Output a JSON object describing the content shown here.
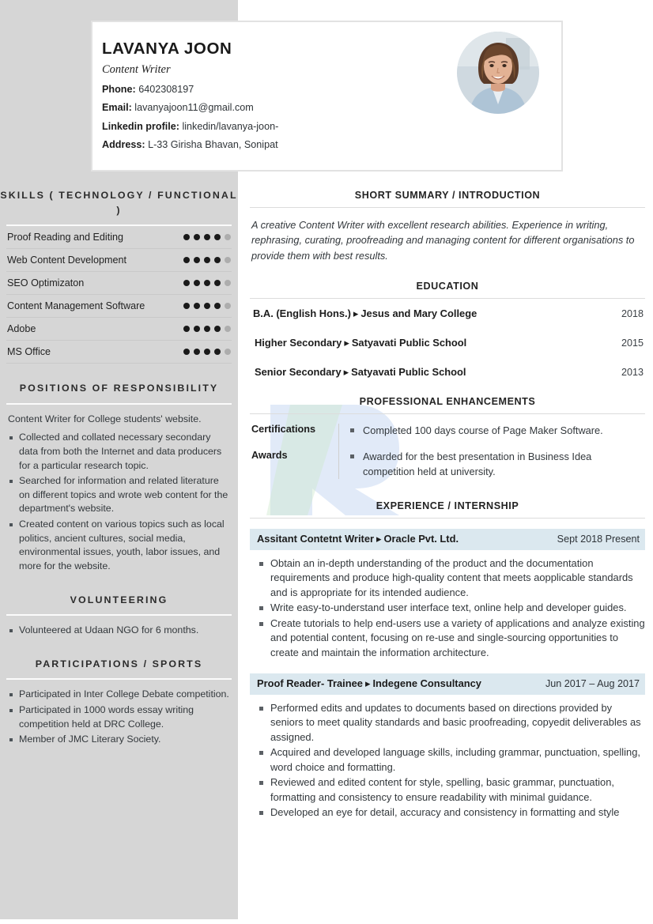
{
  "header": {
    "name": "LAVANYA JOON",
    "job_title": "Content Writer",
    "contacts": [
      {
        "label": "Phone:",
        "value": "6402308197"
      },
      {
        "label": "Email:",
        "value": "lavanyajoon11@gmail.com"
      },
      {
        "label": "Linkedin profile:",
        "value": "linkedin/lavanya-joon-"
      },
      {
        "label": "Address:",
        "value": "L-33 Girisha Bhavan, Sonipat"
      }
    ],
    "photo_alt": "profile-photo"
  },
  "sidebar": {
    "skills": {
      "heading": "SKILLS ( TECHNOLOGY / FUNCTIONAL )",
      "rating_max": 5,
      "items": [
        {
          "name": "Proof Reading and Editing",
          "rating": 4
        },
        {
          "name": "Web Content Development",
          "rating": 4
        },
        {
          "name": "SEO Optimizaton",
          "rating": 4
        },
        {
          "name": "Content Management Software",
          "rating": 4
        },
        {
          "name": "Adobe",
          "rating": 4
        },
        {
          "name": "MS Office",
          "rating": 4
        }
      ]
    },
    "positions": {
      "heading": "POSITIONS OF RESPONSIBILITY",
      "intro": "Content Writer for College students' website.",
      "items": [
        "Collected and collated necessary secondary data from both the Internet and data producers for a particular research topic.",
        "Searched for information and related literature on different topics and wrote web content for the department's website.",
        "Created content on various topics such as local politics, ancient cultures, social media, environmental issues, youth, labor issues, and more for the website."
      ]
    },
    "volunteering": {
      "heading": "VOLUNTEERING",
      "items": [
        "Volunteered at Udaan NGO for 6 months."
      ]
    },
    "participations": {
      "heading": "PARTICIPATIONS / SPORTS",
      "items": [
        "Participated in Inter College Debate competition.",
        "Participated in 1000 words essay writing competition held at DRC College.",
        "Member of JMC Literary Society."
      ]
    }
  },
  "main": {
    "summary": {
      "heading": "SHORT SUMMARY / INTRODUCTION",
      "text": "A creative Content Writer with excellent research abilities. Experience in writing, rephrasing, curating, proofreading and managing content for different organisations to provide them with best results."
    },
    "education": {
      "heading": "EDUCATION",
      "items": [
        {
          "degree": "B.A. (English Hons.)",
          "arrow": "▸",
          "institution": "Jesus and Mary College",
          "year": "2018"
        },
        {
          "degree": "Higher Secondary",
          "arrow": "▸",
          "institution": "Satyavati Public School",
          "year": "2015"
        },
        {
          "degree": "Senior Secondary",
          "arrow": "▸",
          "institution": "Satyavati Public School",
          "year": "2013"
        }
      ]
    },
    "enhancements": {
      "heading": "PROFESSIONAL ENHANCEMENTS",
      "rows": [
        {
          "label": "Certifications",
          "item": "Completed 100 days course of Page Maker Software."
        },
        {
          "label": "Awards",
          "item": "Awarded for the best presentation in Business Idea competition held at university."
        }
      ]
    },
    "experience": {
      "heading": "EXPERIENCE / INTERNSHIP",
      "entries": [
        {
          "role": "Assitant Contetnt Writer",
          "arrow": "▸",
          "company": "Oracle Pvt. Ltd.",
          "date": "Sept 2018 Present",
          "bullets": [
            "Obtain an in-depth understanding of the product and the documentation requirements and produce high-quality content that meets aopplicable standards and is appropriate for its intended audience.",
            "Write easy-to-understand user interface text, online help and developer guides.",
            "Create tutorials to help end-users use a variety of applications and analyze existing and potential content, focusing on re-use and single-sourcing opportunities to create and maintain the information architecture."
          ]
        },
        {
          "role": "Proof Reader- Trainee",
          "arrow": "▸",
          "company": "Indegene Consultancy",
          "date": "Jun 2017 – Aug 2017",
          "bullets": [
            "Performed edits and updates to documents based on directions provided by seniors to meet quality standards and basic proofreading, copyedit deliverables as assigned.",
            "Acquired and developed language skills, including grammar, punctuation, spelling, word choice and formatting.",
            "Reviewed and edited content for style, spelling, basic grammar, punctuation, formatting and consistency to ensure readability with minimal guidance.",
            "Developed an eye for detail, accuracy and consistency in formatting and style"
          ]
        }
      ]
    }
  },
  "colors": {
    "sidebar_bg": "#d6d6d6",
    "experience_bar": "#dbe8ef",
    "dot_on": "#1a1a1a",
    "dot_off": "#adadad",
    "text": "#33383c"
  }
}
